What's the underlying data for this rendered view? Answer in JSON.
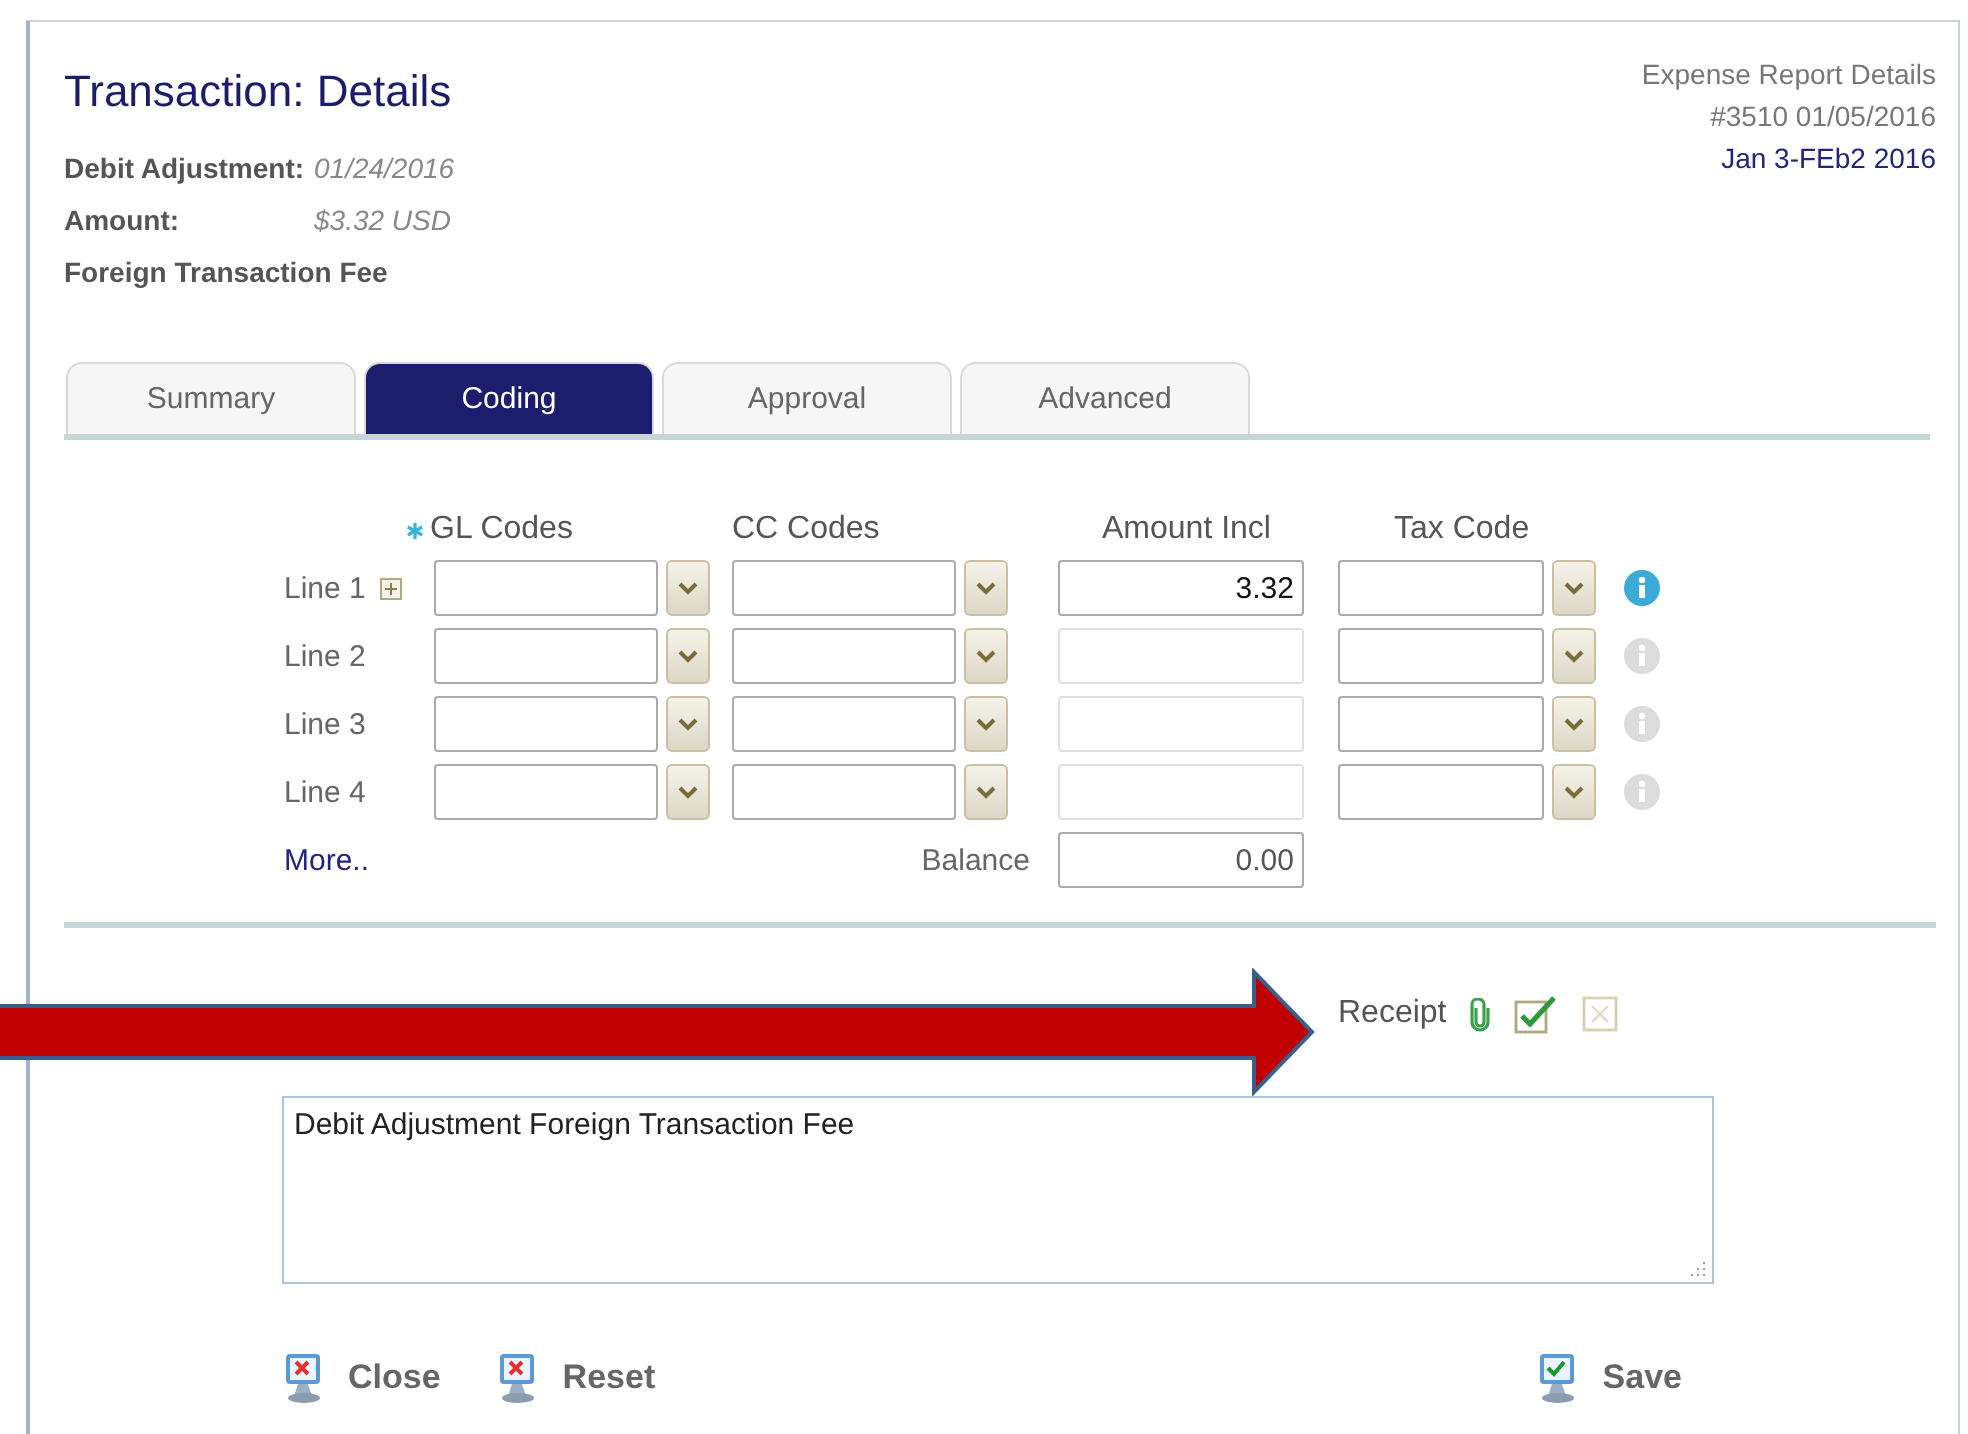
{
  "header": {
    "title": "Transaction: Details",
    "details": [
      {
        "label": "Debit Adjustment:",
        "value": "01/24/2016"
      },
      {
        "label": "Amount:",
        "value": "$3.32 USD"
      }
    ],
    "description": "Foreign Transaction Fee"
  },
  "report": {
    "title": "Expense Report Details",
    "number": "#3510 01/05/2016",
    "period": "Jan 3-FEb2 2016"
  },
  "tabs": [
    {
      "label": "Summary",
      "selected": false
    },
    {
      "label": "Coding",
      "selected": true
    },
    {
      "label": "Approval",
      "selected": false
    },
    {
      "label": "Advanced",
      "selected": false
    }
  ],
  "coding": {
    "columns": [
      {
        "label": "GL Codes",
        "required": true
      },
      {
        "label": "CC Codes",
        "required": false
      },
      {
        "label": "Amount Incl",
        "required": false
      },
      {
        "label": "Tax Code",
        "required": false
      }
    ],
    "lines": [
      {
        "label": "Line 1",
        "expandable": true,
        "amount": "3.32",
        "info_active": true
      },
      {
        "label": "Line 2",
        "expandable": false,
        "info_active": false
      },
      {
        "label": "Line 3",
        "expandable": false,
        "info_active": false
      },
      {
        "label": "Line 4",
        "expandable": false,
        "info_active": false
      }
    ],
    "more_link": "More..",
    "balance": {
      "label": "Balance",
      "value": "0.00"
    }
  },
  "receipt": {
    "label": "Receipt",
    "approved": true
  },
  "note": {
    "value": "Debit Adjustment Foreign Transaction Fee"
  },
  "buttons": [
    {
      "label": "Close",
      "kind": "cancel"
    },
    {
      "label": "Reset",
      "kind": "cancel"
    },
    {
      "label": "Save",
      "kind": "save"
    }
  ]
}
